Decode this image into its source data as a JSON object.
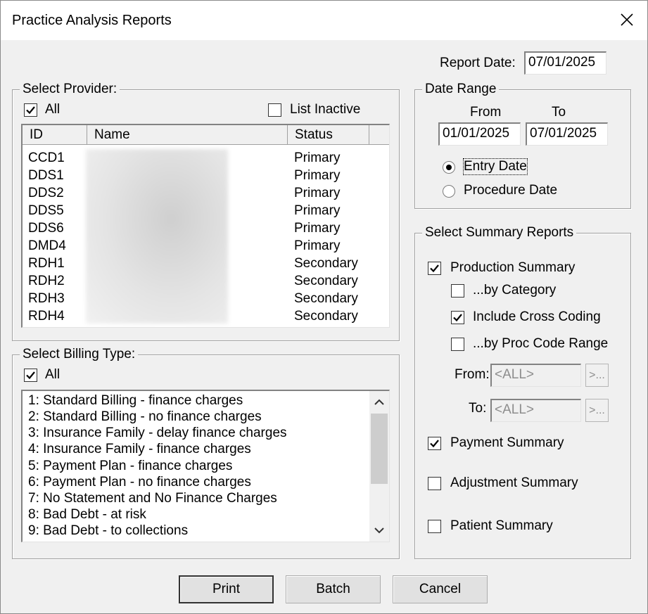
{
  "window": {
    "title": "Practice Analysis Reports"
  },
  "report_date": {
    "label": "Report Date:",
    "value": "07/01/2025"
  },
  "provider": {
    "legend": "Select Provider:",
    "all_label": "All",
    "all_checked": true,
    "list_inactive_label": "List Inactive",
    "list_inactive_checked": false,
    "columns": [
      "ID",
      "Name",
      "Status"
    ],
    "rows": [
      {
        "id": "CCD1",
        "name": "",
        "status": "Primary"
      },
      {
        "id": "DDS1",
        "name": "",
        "status": "Primary"
      },
      {
        "id": "DDS2",
        "name": "",
        "status": "Primary"
      },
      {
        "id": "DDS5",
        "name": "",
        "status": "Primary"
      },
      {
        "id": "DDS6",
        "name": "",
        "status": "Primary"
      },
      {
        "id": "DMD4",
        "name": "",
        "status": "Primary"
      },
      {
        "id": "RDH1",
        "name": "",
        "status": "Secondary"
      },
      {
        "id": "RDH2",
        "name": "",
        "status": "Secondary"
      },
      {
        "id": "RDH3",
        "name": "",
        "status": "Secondary"
      },
      {
        "id": "RDH4",
        "name": "",
        "status": "Secondary"
      }
    ]
  },
  "date_range": {
    "legend": "Date Range",
    "from_label": "From",
    "to_label": "To",
    "from_value": "01/01/2025",
    "to_value": "07/01/2025",
    "options": [
      {
        "label": "Entry Date",
        "selected": true
      },
      {
        "label": "Procedure Date",
        "selected": false
      }
    ]
  },
  "billing": {
    "legend": "Select Billing Type:",
    "all_label": "All",
    "all_checked": true,
    "items": [
      "1: Standard Billing - finance charges",
      "2: Standard Billing - no finance charges",
      "3: Insurance Family - delay finance charges",
      "4: Insurance Family - finance charges",
      "5: Payment Plan - finance charges",
      "6: Payment Plan - no finance charges",
      "7: No Statement and No Finance Charges",
      "8: Bad Debt - at risk",
      "9: Bad Debt - to collections"
    ]
  },
  "summary": {
    "legend": "Select Summary Reports",
    "production_label": "Production Summary",
    "production_checked": true,
    "by_category_label": "...by Category",
    "by_category_checked": false,
    "cross_coding_label": "Include Cross Coding",
    "cross_coding_checked": true,
    "by_proc_range_label": "...by Proc Code Range",
    "by_proc_range_checked": false,
    "from_label": "From:",
    "from_value": "<ALL>",
    "to_label": "To:",
    "to_value": "<ALL>",
    "browse_label": ">...",
    "payment_label": "Payment Summary",
    "payment_checked": true,
    "adjustment_label": "Adjustment Summary",
    "adjustment_checked": false,
    "patient_label": "Patient Summary",
    "patient_checked": false
  },
  "buttons": {
    "print": "Print",
    "batch": "Batch",
    "cancel": "Cancel"
  }
}
